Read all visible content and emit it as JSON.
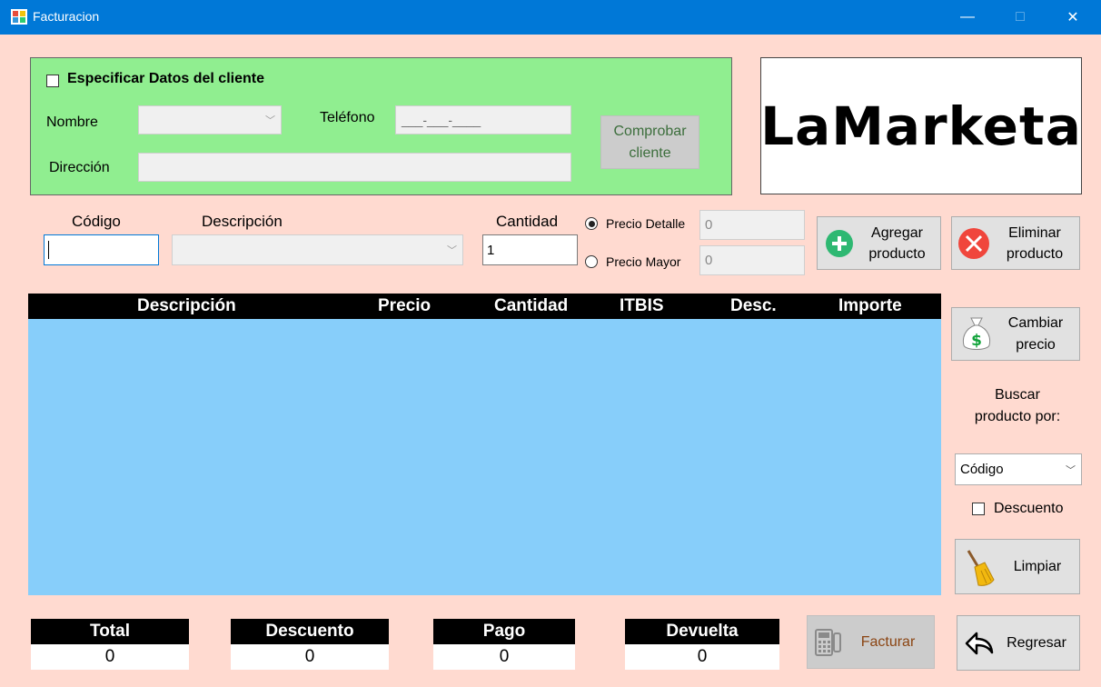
{
  "window": {
    "title": "Facturacion",
    "controls": {
      "minimize": "—",
      "maximize": "□",
      "close": "✕"
    }
  },
  "client": {
    "checkbox_label": "Especificar Datos del cliente",
    "nombre_label": "Nombre",
    "nombre_value": "",
    "telefono_label": "Teléfono",
    "telefono_mask": "___-___-____",
    "direccion_label": "Dirección",
    "direccion_value": "",
    "check_button": "Comprobar cliente"
  },
  "logo": {
    "text": "LaMarketa"
  },
  "product": {
    "codigo_label": "Código",
    "codigo_value": "",
    "descripcion_label": "Descripción",
    "descripcion_value": "",
    "cantidad_label": "Cantidad",
    "cantidad_value": "1",
    "precio_detalle_label": "Precio Detalle",
    "precio_detalle_value": "0",
    "precio_mayor_label": "Precio Mayor",
    "precio_mayor_value": "0",
    "add_button": "Agregar producto",
    "delete_button": "Eliminar producto"
  },
  "table": {
    "columns": [
      "Descripción",
      "Precio",
      "Cantidad",
      "ITBIS",
      "Desc.",
      "Importe"
    ],
    "rows": []
  },
  "side": {
    "cambiar_precio": "Cambiar precio",
    "buscar_label": "Buscar producto por:",
    "buscar_option": "Código",
    "descuento_check": "Descuento",
    "limpiar": "Limpiar"
  },
  "totals": {
    "total_label": "Total",
    "total_value": "0",
    "descuento_label": "Descuento",
    "descuento_value": "0",
    "pago_label": "Pago",
    "pago_value": "0",
    "devuelta_label": "Devuelta",
    "devuelta_value": "0"
  },
  "footer": {
    "facturar": "Facturar",
    "regresar": "Regresar"
  },
  "colors": {
    "background": "#FFDAD0",
    "titlebar": "#0078D7",
    "client_panel": "#90EE90",
    "grid": "#87CEFA",
    "add_icon": "#2EB872",
    "delete_icon": "#F0463C"
  },
  "icons": [
    "app-icon",
    "plus-circle-icon",
    "close-circle-icon",
    "money-bag-icon",
    "broom-icon",
    "calculator-icon",
    "back-arrow-icon",
    "chevron-down-icon"
  ]
}
